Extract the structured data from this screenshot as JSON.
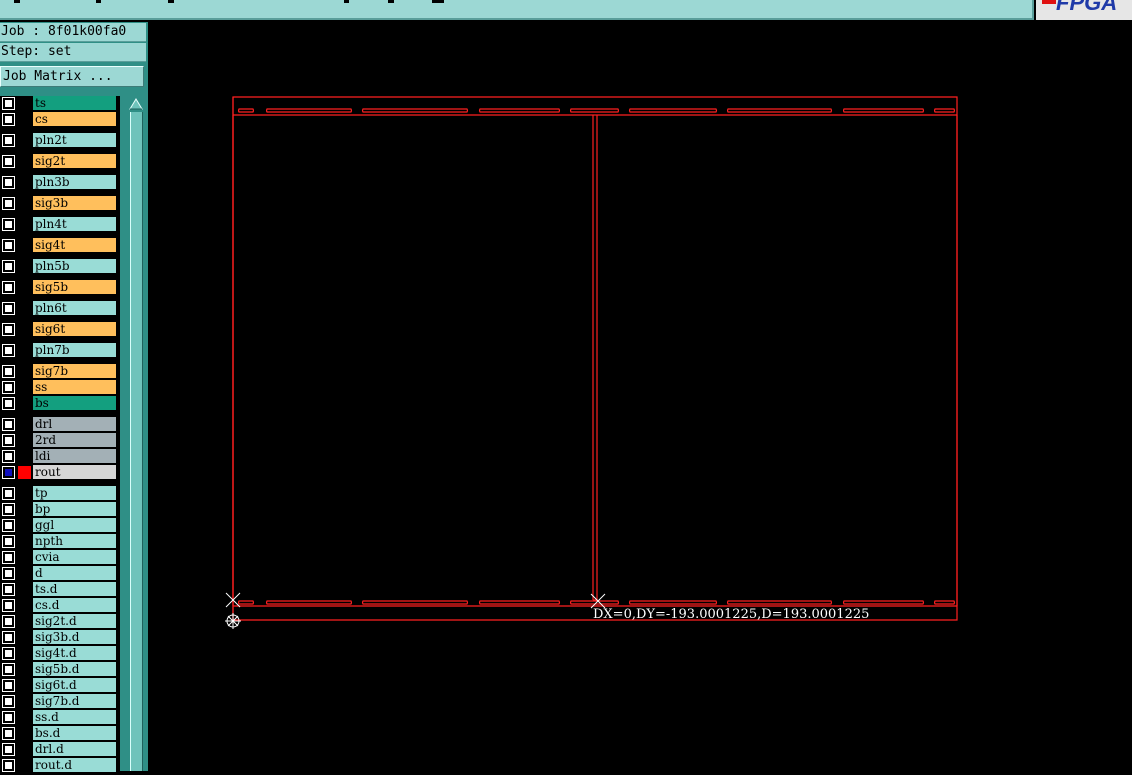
{
  "header": {
    "logo_text": "FPGA"
  },
  "job": {
    "job_line": "Job : 8f01k00fa0",
    "step_line": "Step: set"
  },
  "job_matrix_button": "Job Matrix ...",
  "layers": [
    {
      "name": "ts",
      "color": "#139f7f",
      "group": 0
    },
    {
      "name": "cs",
      "color": "#ffbf5c",
      "group": 0
    },
    {
      "name": "pln2t",
      "color": "#99dcd6",
      "group": 1
    },
    {
      "name": "sig2t",
      "color": "#ffbf5c",
      "group": 2
    },
    {
      "name": "pln3b",
      "color": "#99dcd6",
      "group": 3
    },
    {
      "name": "sig3b",
      "color": "#ffbf5c",
      "group": 4
    },
    {
      "name": "pln4t",
      "color": "#99dcd6",
      "group": 5
    },
    {
      "name": "sig4t",
      "color": "#ffbf5c",
      "group": 6
    },
    {
      "name": "pln5b",
      "color": "#99dcd6",
      "group": 7
    },
    {
      "name": "sig5b",
      "color": "#ffbf5c",
      "group": 8
    },
    {
      "name": "pln6t",
      "color": "#99dcd6",
      "group": 9
    },
    {
      "name": "sig6t",
      "color": "#ffbf5c",
      "group": 10
    },
    {
      "name": "pln7b",
      "color": "#99dcd6",
      "group": 11
    },
    {
      "name": "sig7b",
      "color": "#ffbf5c",
      "group": 12
    },
    {
      "name": "ss",
      "color": "#ffbf5c",
      "group": 12
    },
    {
      "name": "bs",
      "color": "#139f7f",
      "group": 12
    },
    {
      "name": "drl",
      "color": "#a3b0b6",
      "group": 13
    },
    {
      "name": "2rd",
      "color": "#a3b0b6",
      "group": 13
    },
    {
      "name": "ldi",
      "color": "#a3b0b6",
      "group": 13
    },
    {
      "name": "rout",
      "color": "#d6d6d6",
      "group": 13,
      "active": true
    },
    {
      "name": "tp",
      "color": "#99dcd6",
      "group": 14
    },
    {
      "name": "bp",
      "color": "#99dcd6",
      "group": 14
    },
    {
      "name": "ggl",
      "color": "#99dcd6",
      "group": 14
    },
    {
      "name": "npth",
      "color": "#99dcd6",
      "group": 14
    },
    {
      "name": "cvia",
      "color": "#99dcd6",
      "group": 14
    },
    {
      "name": "d",
      "color": "#99dcd6",
      "group": 14
    },
    {
      "name": "ts.d",
      "color": "#99dcd6",
      "group": 14
    },
    {
      "name": "cs.d",
      "color": "#99dcd6",
      "group": 14
    },
    {
      "name": "sig2t.d",
      "color": "#99dcd6",
      "group": 14
    },
    {
      "name": "sig3b.d",
      "color": "#99dcd6",
      "group": 14
    },
    {
      "name": "sig4t.d",
      "color": "#99dcd6",
      "group": 14
    },
    {
      "name": "sig5b.d",
      "color": "#99dcd6",
      "group": 14
    },
    {
      "name": "sig6t.d",
      "color": "#99dcd6",
      "group": 14
    },
    {
      "name": "sig7b.d",
      "color": "#99dcd6",
      "group": 14
    },
    {
      "name": "ss.d",
      "color": "#99dcd6",
      "group": 14
    },
    {
      "name": "bs.d",
      "color": "#99dcd6",
      "group": 14
    },
    {
      "name": "drl.d",
      "color": "#99dcd6",
      "group": 14
    },
    {
      "name": "rout.d",
      "color": "#99dcd6",
      "group": 14
    }
  ],
  "active_layer_color": "#ff0000",
  "canvas": {
    "measurement": "DX=0,DY=-193.0001225,D=193.0001225",
    "outline_color": "#ff2020",
    "marker_color": "#ffffff"
  }
}
